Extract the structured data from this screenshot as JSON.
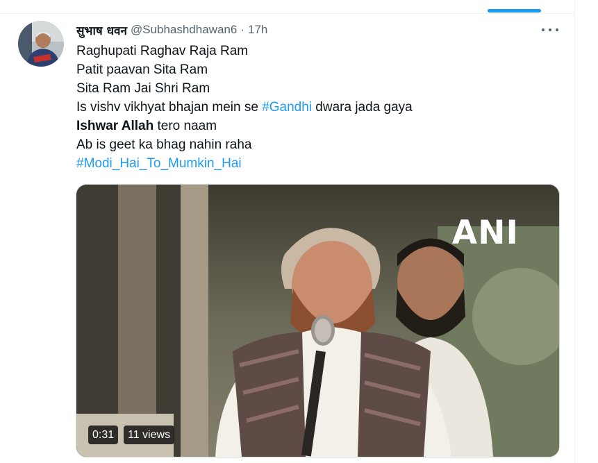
{
  "author": {
    "display_name": "सुभाष धवन",
    "handle": "@Subhashdhawan6",
    "separator": "·",
    "timestamp": "17h"
  },
  "tweet": {
    "lines": [
      [
        {
          "text": "Raghupati Raghav Raja Ram"
        }
      ],
      [
        {
          "text": "Patit paavan Sita Ram"
        }
      ],
      [
        {
          "text": "Sita Ram Jai Shri Ram"
        }
      ],
      [
        {
          "text": "Is vishv vikhyat bhajan mein se "
        },
        {
          "text": "#Gandhi",
          "hashtag": true
        },
        {
          "text": " dwara jada gaya"
        }
      ],
      [
        {
          "text": "Ishwar Allah",
          "bold": true
        },
        {
          "text": " tero naam"
        }
      ],
      [
        {
          "text": "Ab is geet ka bhag nahin raha"
        }
      ],
      [
        {
          "text": "#Modi_Hai_To_Mumkin_Hai",
          "hashtag": true
        }
      ]
    ]
  },
  "media": {
    "watermark": "ANI",
    "duration": "0:31",
    "views": "11 views"
  },
  "icons": {
    "more": "more-horizontal-icon"
  },
  "colors": {
    "accent": "#1d9bf0",
    "text_primary": "#0f1419",
    "text_secondary": "#536471"
  }
}
